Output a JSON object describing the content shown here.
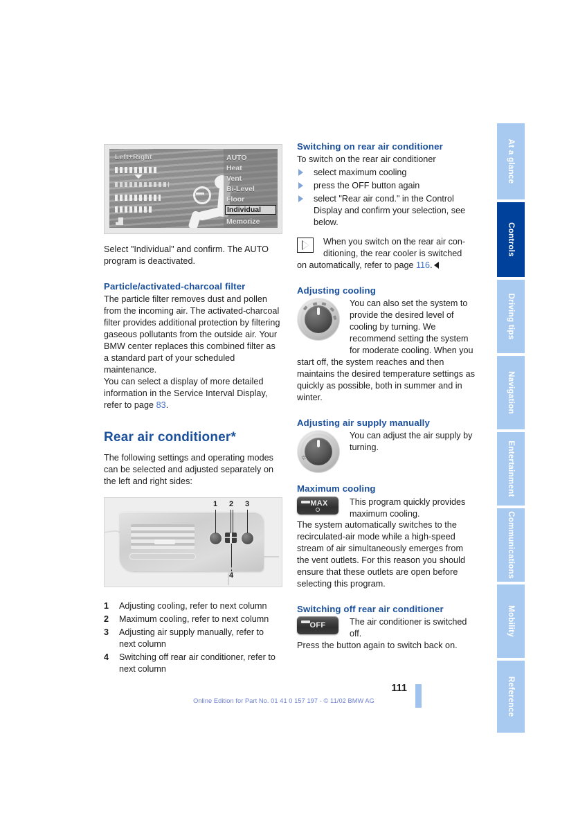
{
  "document": {
    "page_number": "111",
    "footer_note": "Online Edition for Part No. 01 41 0 157 197 - © 11/02 BMW AG"
  },
  "sidebar": {
    "tabs": [
      {
        "label": "At a glance",
        "active": false
      },
      {
        "label": "Controls",
        "active": true
      },
      {
        "label": "Driving tips",
        "active": false
      },
      {
        "label": "Navigation",
        "active": false
      },
      {
        "label": "Entertainment",
        "active": false
      },
      {
        "label": "Communications",
        "active": false
      },
      {
        "label": "Mobility",
        "active": false
      },
      {
        "label": "Reference",
        "active": false
      }
    ],
    "active_color": "#00429b",
    "inactive_color": "#a8caf0"
  },
  "left_column": {
    "control_display_figure": {
      "caption_left": "Left+Right",
      "menu_items": [
        {
          "label": "AUTO",
          "selected": false
        },
        {
          "label": "Heat",
          "selected": false
        },
        {
          "label": "Vent",
          "selected": false
        },
        {
          "label": "Bi-Level",
          "selected": false
        },
        {
          "label": "Floor",
          "selected": false
        },
        {
          "label": "Individual",
          "selected": true
        },
        {
          "label": "Memorize",
          "selected": false
        }
      ]
    },
    "intro_paragraph": "Select \"Individual\" and confirm. The AUTO program is deactivated.",
    "filter_heading": "Particle/activated-charcoal filter",
    "filter_paragraph_1": "The particle filter removes dust and pollen from the incoming air. The activated-charcoal filter provides additional protection by filtering gaseous pollutants from the outside air. Your BMW center replaces this combined filter as a standard part of your scheduled maintenance.",
    "filter_paragraph_2_pre": "You can select a display of more detailed information in the Service Interval Display, refer to page ",
    "filter_paragraph_2_page": "83",
    "filter_paragraph_2_post": ".",
    "rear_ac_heading": "Rear air conditioner*",
    "rear_ac_intro": "The following settings and operating modes can be selected and adjusted separately on the left and right sides:",
    "vent_figure": {
      "callouts": [
        "1",
        "2",
        "3",
        "4"
      ]
    },
    "legend": [
      {
        "num": "1",
        "text": "Adjusting cooling, refer to next column"
      },
      {
        "num": "2",
        "text": "Maximum cooling, refer to next column"
      },
      {
        "num": "3",
        "text": "Adjusting air supply manually, refer to next column"
      },
      {
        "num": "4",
        "text": "Switching off rear air conditioner, refer to next column"
      }
    ]
  },
  "right_column": {
    "switch_on_heading": "Switching on rear air conditioner",
    "switch_on_intro": "To switch on the rear air conditioner",
    "switch_on_steps": [
      "select maximum cooling",
      "press the OFF button again",
      "select \"Rear air cond.\" in the Control Display and confirm your selection, see below."
    ],
    "note": {
      "line1": "When you switch on the rear air con-",
      "line2": "ditioning, the rear cooler is switched",
      "line3_pre": "on automatically, refer to page ",
      "line3_page": "116",
      "line3_post": "."
    },
    "adjusting_cooling_heading": "Adjusting cooling",
    "adjusting_cooling_wrapped": "You can also set the system to provide the desired level of cooling by turning. We recommend setting the system for moderate cooling. When you",
    "adjusting_cooling_rest": "start off, the system reaches and then maintains the desired temperature settings as quickly as possible, both in summer and in winter.",
    "air_supply_heading": "Adjusting air supply manually",
    "air_supply_text": "You can adjust the air supply by turning.",
    "max_cooling_heading": "Maximum cooling",
    "max_button_label": "MAX",
    "max_cooling_text_wrapped": "This program quickly provides maximum cooling.",
    "max_cooling_rest": "The system automatically switches to the recirculated-air mode while a high-speed stream of air simultaneously emerges from the vent outlets. For this reason you should ensure that these outlets are open before selecting this program.",
    "switch_off_heading": "Switching off rear air conditioner",
    "off_button_label": "OFF",
    "switch_off_text_wrapped": "The air conditioner is switched off.",
    "switch_off_rest": "Press the button again to switch back on."
  }
}
